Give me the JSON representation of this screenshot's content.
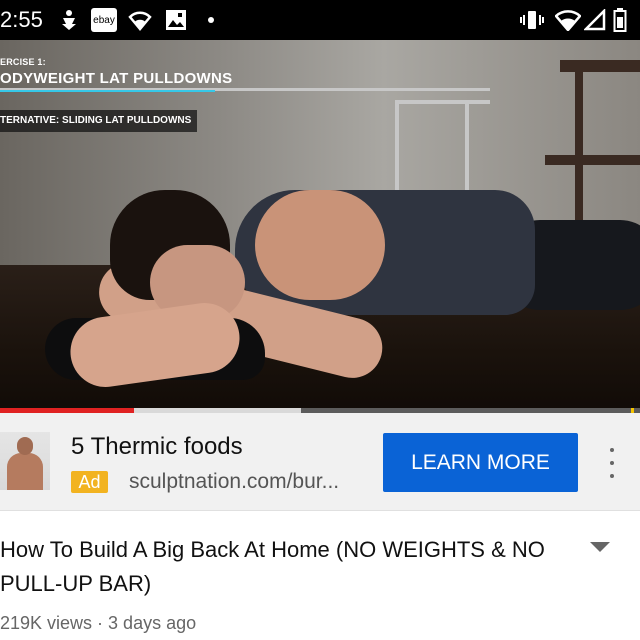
{
  "status_bar": {
    "time": "2:55",
    "notification_icons": [
      "download-icon",
      "ebay-icon",
      "wifi-icon",
      "image-icon",
      "dot-icon"
    ],
    "ebay_label": "ebay",
    "system_icons": [
      "vibrate-icon",
      "wifi-icon",
      "signal-icon",
      "battery-icon"
    ]
  },
  "video": {
    "overlay_label": "ERCISE 1:",
    "overlay_title": "ODYWEIGHT LAT PULLDOWNS",
    "overlay_alt": "TERNATIVE: SLIDING LAT PULLDOWNS",
    "accent_color": "#36c8e8",
    "progress_played_fraction": 0.21,
    "progress_buffered_fraction": 0.47,
    "ad_marker_fractions": [
      0.99
    ]
  },
  "ad": {
    "title": "5 Thermic foods",
    "badge": "Ad",
    "url": "sculptnation.com/bur...",
    "cta_label": "LEARN MORE",
    "cta_color": "#0a63d6",
    "badge_color": "#f2b320"
  },
  "video_info": {
    "title": "How To Build A Big Back At Home (NO WEIGHTS & NO PULL-UP BAR)",
    "meta": "219K views · 3 days ago"
  }
}
